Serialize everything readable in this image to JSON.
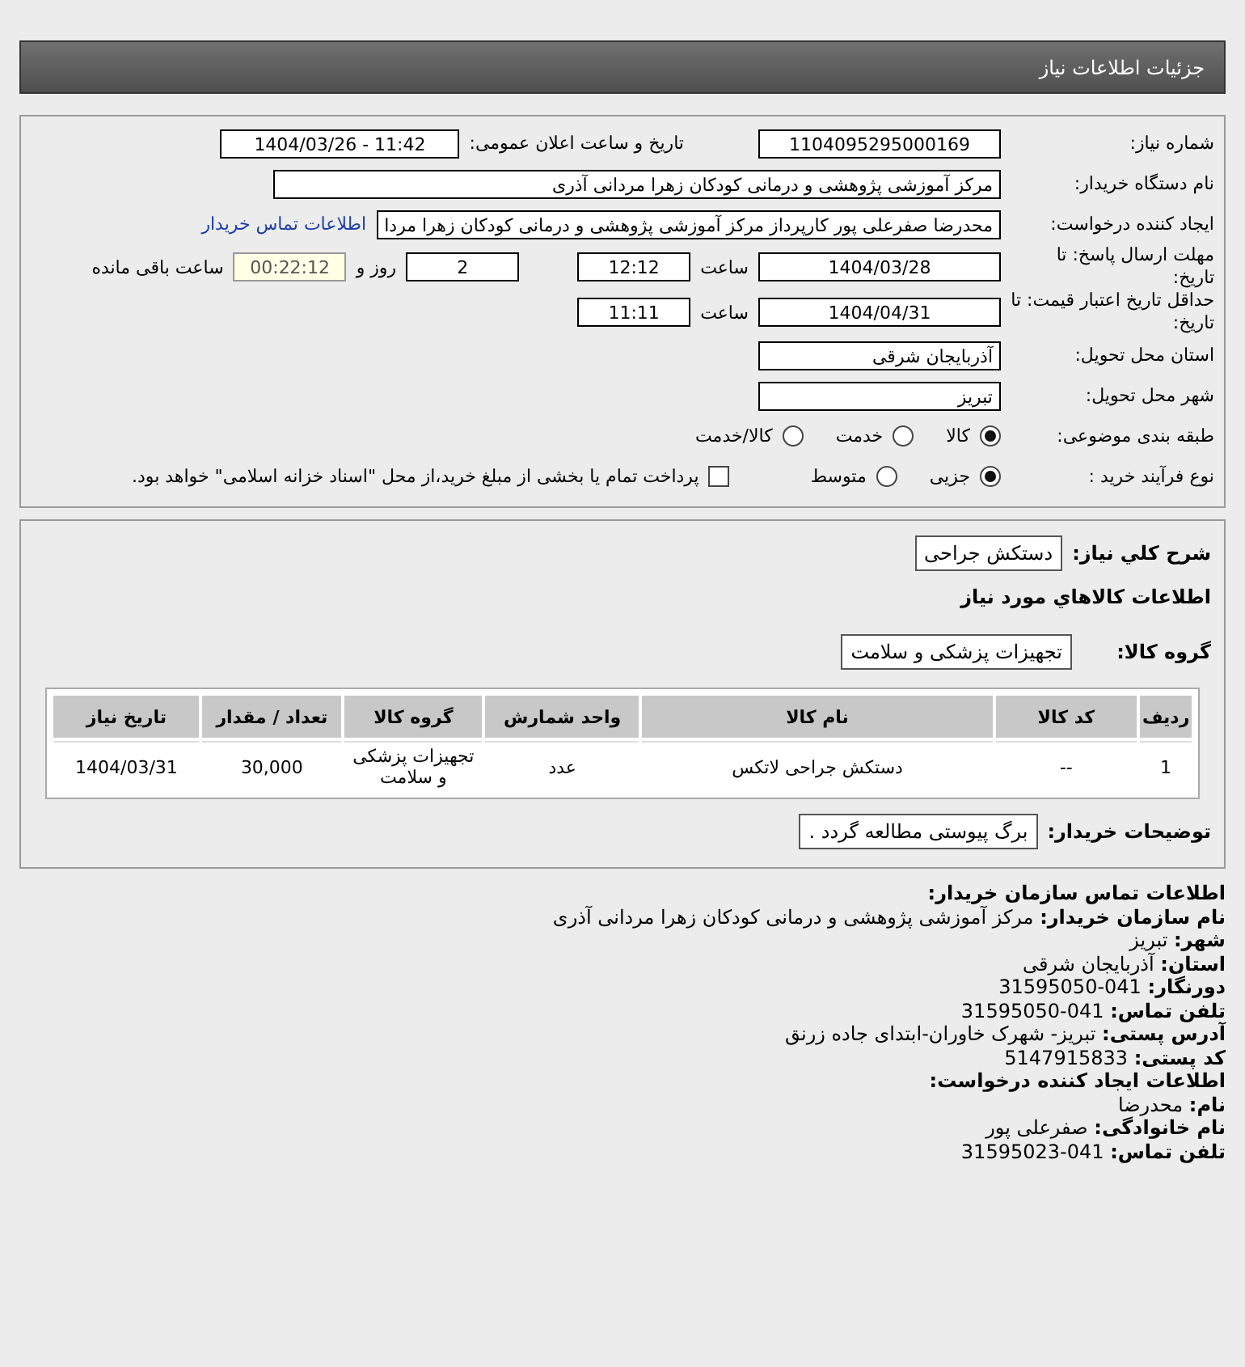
{
  "header": {
    "title": "جزئیات اطلاعات نیاز"
  },
  "details": {
    "need_number": {
      "label": "شماره نیاز:",
      "value": "1104095295000169"
    },
    "announce": {
      "label": "تاریخ و ساعت اعلان عمومی:",
      "value": "1404/03/26 - 11:42"
    },
    "buyer": {
      "label": "نام دستگاه خریدار:",
      "value": "مرکز آموزشی پژوهشی و درمانی کودکان زهرا مردانی آذری"
    },
    "requester": {
      "label": "ایجاد کننده درخواست:",
      "value": "محدرضا صفرعلی پور کارپرداز مرکز آموزشی پژوهشی و درمانی کودکان زهرا مردا",
      "link": "اطلاعات تماس خریدار"
    },
    "deadline": {
      "label": "مهلت ارسال پاسخ: تا تاریخ:",
      "date": "1404/03/28",
      "time_label": "ساعت",
      "time": "12:12",
      "days": "2",
      "days_label": "روز و",
      "remaining": "00:22:12",
      "remaining_label": "ساعت باقی مانده"
    },
    "validity": {
      "label": "حداقل تاریخ اعتبار قیمت: تا تاریخ:",
      "date": "1404/04/31",
      "time_label": "ساعت",
      "time": "11:11"
    },
    "province": {
      "label": "استان محل تحویل:",
      "value": "آذربایجان شرقی"
    },
    "city": {
      "label": "شهر محل تحویل:",
      "value": "تبریز"
    },
    "category": {
      "label": "طبقه بندی موضوعی:",
      "options": [
        {
          "label": "کالا",
          "selected": true
        },
        {
          "label": "خدمت",
          "selected": false
        },
        {
          "label": "کالا/خدمت",
          "selected": false
        }
      ]
    },
    "process": {
      "label": "نوع فرآیند خرید :",
      "options": [
        {
          "label": "جزیی",
          "selected": true
        },
        {
          "label": "متوسط",
          "selected": false
        }
      ],
      "payment": {
        "label": "پرداخت تمام یا بخشی از مبلغ خرید،از محل \"اسناد خزانه اسلامی\" خواهد بود.",
        "checked": false
      }
    }
  },
  "goods": {
    "summary": {
      "label": "شرح کلي نياز:",
      "value": "دستکش جراحی"
    },
    "heading": "اطلاعات كالاهاي مورد نياز",
    "group": {
      "label": "گروه کالا:",
      "value": "تجهیزات پزشکی و سلامت"
    },
    "table": {
      "columns": [
        "ردیف",
        "کد کالا",
        "نام کالا",
        "واحد شمارش",
        "گروه کالا",
        "تعداد / مقدار",
        "تاریخ نیاز"
      ],
      "rows": [
        [
          "1",
          "--",
          "دستکش جراحی لاتکس",
          "عدد",
          "تجهیزات پزشکی و سلامت",
          "30,000",
          "1404/03/31"
        ]
      ]
    },
    "notes": {
      "label": "توضیحات خریدار:",
      "value": "برگ پیوستی مطالعه گردد ."
    }
  },
  "contact": [
    {
      "kind": "heading",
      "label": "اطلاعات تماس سازمان خریدار:"
    },
    {
      "kind": "field",
      "label": "نام سازمان خریدار:",
      "value": "مرکز آموزشی پژوهشی و درمانی کودکان زهرا مردانی آذری"
    },
    {
      "kind": "field",
      "label": "شهر:",
      "value": "تبریز"
    },
    {
      "kind": "field",
      "label": "استان:",
      "value": "آذربایجان شرقی"
    },
    {
      "kind": "field",
      "label": "دورنگار:",
      "value": "31595050-041"
    },
    {
      "kind": "field",
      "label": "تلفن تماس:",
      "value": "31595050-041"
    },
    {
      "kind": "field",
      "label": "آدرس پستی:",
      "value": "تبریز- شهرک خاوران-ابتدای جاده زرنق"
    },
    {
      "kind": "field",
      "label": "کد پستی:",
      "value": "5147915833"
    },
    {
      "kind": "heading",
      "label": "اطلاعات ایجاد کننده درخواست:"
    },
    {
      "kind": "field",
      "label": "نام:",
      "value": "محدرضا"
    },
    {
      "kind": "field",
      "label": "نام خانوادگی:",
      "value": "صفرعلی پور"
    },
    {
      "kind": "field",
      "label": "تلفن تماس:",
      "value": "31595023-041"
    }
  ]
}
